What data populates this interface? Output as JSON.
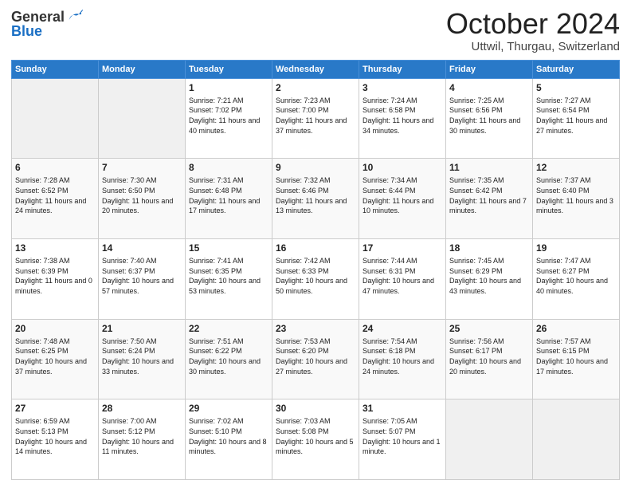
{
  "header": {
    "logo_general": "General",
    "logo_blue": "Blue",
    "month_title": "October 2024",
    "location": "Uttwil, Thurgau, Switzerland"
  },
  "weekdays": [
    "Sunday",
    "Monday",
    "Tuesday",
    "Wednesday",
    "Thursday",
    "Friday",
    "Saturday"
  ],
  "rows": [
    [
      {
        "day": "",
        "info": ""
      },
      {
        "day": "",
        "info": ""
      },
      {
        "day": "1",
        "info": "Sunrise: 7:21 AM\nSunset: 7:02 PM\nDaylight: 11 hours and 40 minutes."
      },
      {
        "day": "2",
        "info": "Sunrise: 7:23 AM\nSunset: 7:00 PM\nDaylight: 11 hours and 37 minutes."
      },
      {
        "day": "3",
        "info": "Sunrise: 7:24 AM\nSunset: 6:58 PM\nDaylight: 11 hours and 34 minutes."
      },
      {
        "day": "4",
        "info": "Sunrise: 7:25 AM\nSunset: 6:56 PM\nDaylight: 11 hours and 30 minutes."
      },
      {
        "day": "5",
        "info": "Sunrise: 7:27 AM\nSunset: 6:54 PM\nDaylight: 11 hours and 27 minutes."
      }
    ],
    [
      {
        "day": "6",
        "info": "Sunrise: 7:28 AM\nSunset: 6:52 PM\nDaylight: 11 hours and 24 minutes."
      },
      {
        "day": "7",
        "info": "Sunrise: 7:30 AM\nSunset: 6:50 PM\nDaylight: 11 hours and 20 minutes."
      },
      {
        "day": "8",
        "info": "Sunrise: 7:31 AM\nSunset: 6:48 PM\nDaylight: 11 hours and 17 minutes."
      },
      {
        "day": "9",
        "info": "Sunrise: 7:32 AM\nSunset: 6:46 PM\nDaylight: 11 hours and 13 minutes."
      },
      {
        "day": "10",
        "info": "Sunrise: 7:34 AM\nSunset: 6:44 PM\nDaylight: 11 hours and 10 minutes."
      },
      {
        "day": "11",
        "info": "Sunrise: 7:35 AM\nSunset: 6:42 PM\nDaylight: 11 hours and 7 minutes."
      },
      {
        "day": "12",
        "info": "Sunrise: 7:37 AM\nSunset: 6:40 PM\nDaylight: 11 hours and 3 minutes."
      }
    ],
    [
      {
        "day": "13",
        "info": "Sunrise: 7:38 AM\nSunset: 6:39 PM\nDaylight: 11 hours and 0 minutes."
      },
      {
        "day": "14",
        "info": "Sunrise: 7:40 AM\nSunset: 6:37 PM\nDaylight: 10 hours and 57 minutes."
      },
      {
        "day": "15",
        "info": "Sunrise: 7:41 AM\nSunset: 6:35 PM\nDaylight: 10 hours and 53 minutes."
      },
      {
        "day": "16",
        "info": "Sunrise: 7:42 AM\nSunset: 6:33 PM\nDaylight: 10 hours and 50 minutes."
      },
      {
        "day": "17",
        "info": "Sunrise: 7:44 AM\nSunset: 6:31 PM\nDaylight: 10 hours and 47 minutes."
      },
      {
        "day": "18",
        "info": "Sunrise: 7:45 AM\nSunset: 6:29 PM\nDaylight: 10 hours and 43 minutes."
      },
      {
        "day": "19",
        "info": "Sunrise: 7:47 AM\nSunset: 6:27 PM\nDaylight: 10 hours and 40 minutes."
      }
    ],
    [
      {
        "day": "20",
        "info": "Sunrise: 7:48 AM\nSunset: 6:25 PM\nDaylight: 10 hours and 37 minutes."
      },
      {
        "day": "21",
        "info": "Sunrise: 7:50 AM\nSunset: 6:24 PM\nDaylight: 10 hours and 33 minutes."
      },
      {
        "day": "22",
        "info": "Sunrise: 7:51 AM\nSunset: 6:22 PM\nDaylight: 10 hours and 30 minutes."
      },
      {
        "day": "23",
        "info": "Sunrise: 7:53 AM\nSunset: 6:20 PM\nDaylight: 10 hours and 27 minutes."
      },
      {
        "day": "24",
        "info": "Sunrise: 7:54 AM\nSunset: 6:18 PM\nDaylight: 10 hours and 24 minutes."
      },
      {
        "day": "25",
        "info": "Sunrise: 7:56 AM\nSunset: 6:17 PM\nDaylight: 10 hours and 20 minutes."
      },
      {
        "day": "26",
        "info": "Sunrise: 7:57 AM\nSunset: 6:15 PM\nDaylight: 10 hours and 17 minutes."
      }
    ],
    [
      {
        "day": "27",
        "info": "Sunrise: 6:59 AM\nSunset: 5:13 PM\nDaylight: 10 hours and 14 minutes."
      },
      {
        "day": "28",
        "info": "Sunrise: 7:00 AM\nSunset: 5:12 PM\nDaylight: 10 hours and 11 minutes."
      },
      {
        "day": "29",
        "info": "Sunrise: 7:02 AM\nSunset: 5:10 PM\nDaylight: 10 hours and 8 minutes."
      },
      {
        "day": "30",
        "info": "Sunrise: 7:03 AM\nSunset: 5:08 PM\nDaylight: 10 hours and 5 minutes."
      },
      {
        "day": "31",
        "info": "Sunrise: 7:05 AM\nSunset: 5:07 PM\nDaylight: 10 hours and 1 minute."
      },
      {
        "day": "",
        "info": ""
      },
      {
        "day": "",
        "info": ""
      }
    ]
  ]
}
